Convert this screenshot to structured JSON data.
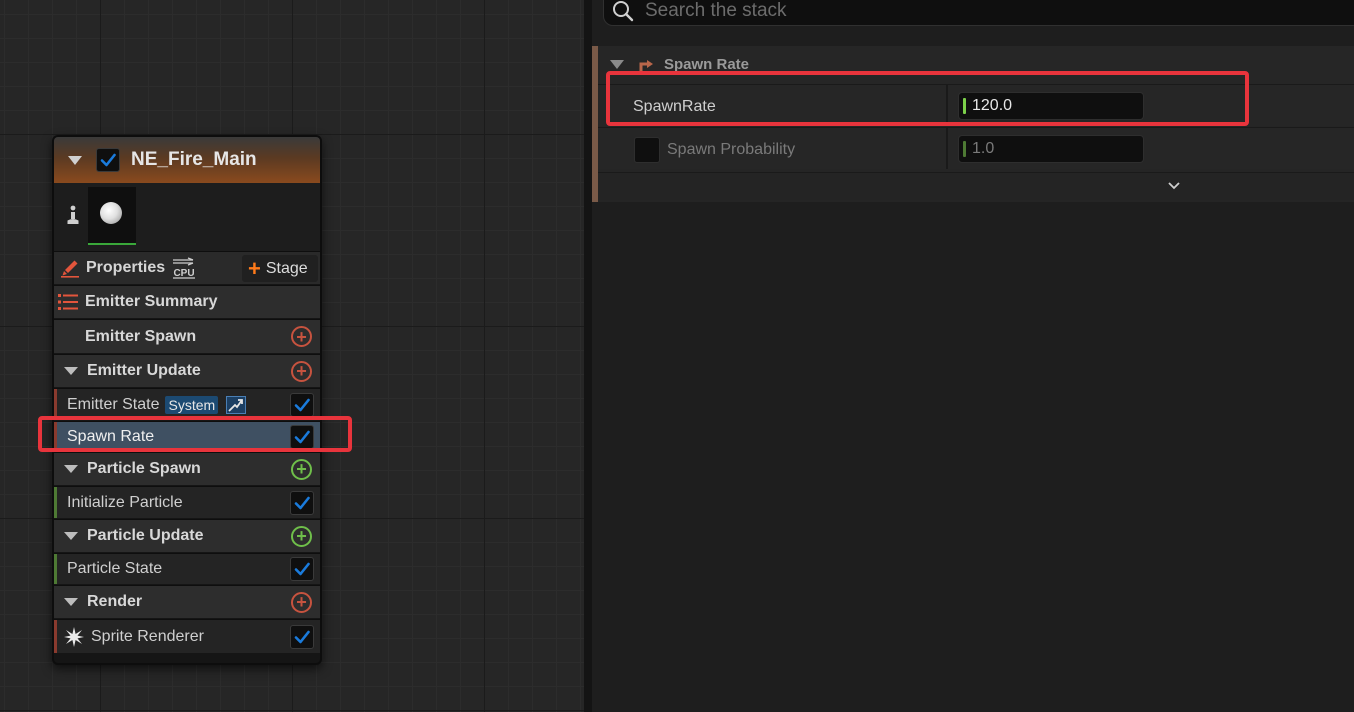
{
  "graph": {
    "node": {
      "title": "NE_Fire_Main",
      "enabled": true,
      "properties_label": "Properties",
      "sim_target": "CPU",
      "stage_button_label": "Stage",
      "rows": [
        {
          "label": "Emitter Summary",
          "kind": "summary"
        },
        {
          "label": "Emitter Spawn",
          "kind": "group"
        },
        {
          "label": "Emitter Update",
          "kind": "group"
        },
        {
          "label": "Emitter State",
          "kind": "module",
          "badge": "System",
          "checked": true
        },
        {
          "label": "Spawn Rate",
          "kind": "module",
          "checked": true,
          "selected": true
        },
        {
          "label": "Particle Spawn",
          "kind": "group"
        },
        {
          "label": "Initialize Particle",
          "kind": "module",
          "checked": true
        },
        {
          "label": "Particle Update",
          "kind": "group"
        },
        {
          "label": "Particle State",
          "kind": "module",
          "checked": true
        },
        {
          "label": "Render",
          "kind": "group"
        },
        {
          "label": "Sprite Renderer",
          "kind": "module",
          "checked": true
        }
      ]
    }
  },
  "stack": {
    "search": {
      "placeholder": "Search the stack",
      "value": ""
    },
    "section_title": "Spawn Rate",
    "properties": [
      {
        "label": "SpawnRate",
        "value": "120.0",
        "highlighted": true
      },
      {
        "label": "Spawn Probability",
        "value": "1.0",
        "enabled": false
      }
    ]
  },
  "colors": {
    "highlight": "#e8343c",
    "check_blue": "#1a7bdc",
    "spawn_group_green": "#6fbf4a",
    "add_red": "#c7533f",
    "header_orange": "#8a4a1e"
  }
}
